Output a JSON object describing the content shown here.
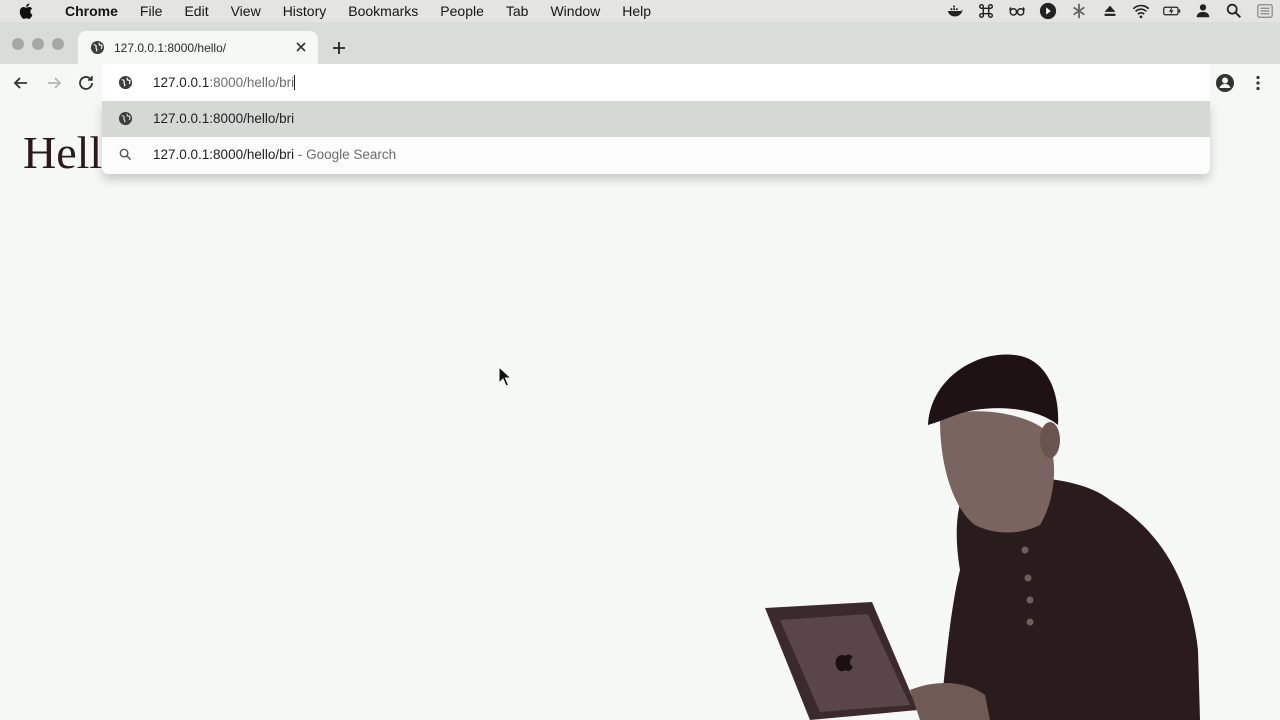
{
  "menubar": {
    "app_name": "Chrome",
    "items": [
      "File",
      "Edit",
      "View",
      "History",
      "Bookmarks",
      "People",
      "Tab",
      "Window",
      "Help"
    ],
    "status_icons": [
      "docker-icon",
      "command-icon",
      "glasses-icon",
      "play-icon",
      "fan-icon",
      "eject-icon",
      "wifi-icon",
      "battery-icon",
      "user-icon",
      "search-icon",
      "list-icon"
    ]
  },
  "tab": {
    "title": "127.0.0.1:8000/hello/"
  },
  "omnibox": {
    "host": "127.0.0.1",
    "path": ":8000/hello/bri"
  },
  "suggestions": [
    {
      "text": "127.0.0.1:8000/hello/bri",
      "secondary": "",
      "icon": "globe-icon"
    },
    {
      "text": "127.0.0.1:8000/hello/bri",
      "secondary": " - Google Search",
      "icon": "search-icon"
    }
  ],
  "page": {
    "heading": "Hell"
  },
  "colors": {
    "menubar_bg": "#e4e5e3",
    "tabstrip_bg": "#dadcda",
    "page_bg": "#f6f8f6",
    "selected_suggestion": "#d6d8d6",
    "heading_text": "#2a1a1c"
  }
}
